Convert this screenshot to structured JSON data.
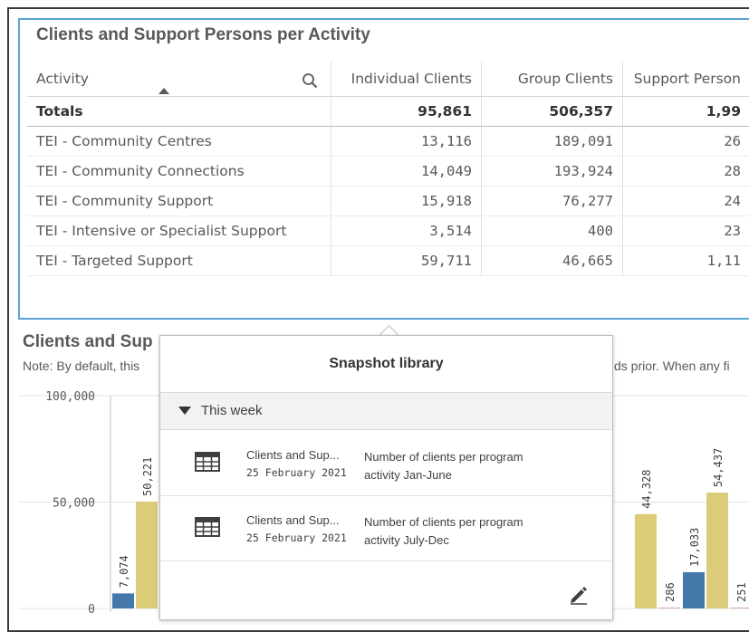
{
  "table": {
    "title": "Clients and Support Persons per Activity",
    "headers": [
      "Activity",
      "Individual Clients",
      "Group Clients",
      "Support Person"
    ],
    "totals": {
      "label": "Totals",
      "individual": "95,861",
      "group": "506,357",
      "support": "1,99"
    },
    "rows": [
      {
        "activity": "TEI - Community Centres",
        "individual": "13,116",
        "group": "189,091",
        "support": "26"
      },
      {
        "activity": "TEI - Community Connections",
        "individual": "14,049",
        "group": "193,924",
        "support": "28"
      },
      {
        "activity": "TEI - Community Support",
        "individual": "15,918",
        "group": "76,277",
        "support": "24"
      },
      {
        "activity": "TEI - Intensive or Specialist Support",
        "individual": "3,514",
        "group": "400",
        "support": "23"
      },
      {
        "activity": "TEI - Targeted Support",
        "individual": "59,711",
        "group": "46,665",
        "support": "1,11"
      }
    ]
  },
  "chart_section": {
    "title": "Clients and Sup",
    "note_left": "Note: By default, this",
    "note_right": "ds prior. When any fi"
  },
  "chart_data": {
    "type": "bar",
    "ylim": [
      0,
      100000
    ],
    "yticks": [
      "100,000",
      "50,000",
      "0"
    ],
    "colors": {
      "blue": "#4477aa",
      "gold": "#dccb78"
    },
    "bars": [
      {
        "group": 0,
        "series": "blue",
        "value": 7074,
        "label": "7,074"
      },
      {
        "group": 0,
        "series": "gold",
        "value": 50221,
        "label": "50,221"
      },
      {
        "group": 5,
        "series": "gold",
        "value": 44328,
        "label": "44,328"
      },
      {
        "group": 5,
        "series": "pink",
        "value": 286,
        "label": "286"
      },
      {
        "group": 6,
        "series": "blue",
        "value": 17033,
        "label": "17,033"
      },
      {
        "group": 6,
        "series": "gold",
        "value": 54437,
        "label": "54,437"
      },
      {
        "group": 6,
        "series": "pink",
        "value": 251,
        "label": "251"
      }
    ]
  },
  "popover": {
    "title": "Snapshot library",
    "group_label": "This week",
    "snapshots": [
      {
        "name": "Clients and Sup...",
        "date": "25 February 2021",
        "description": "Number of clients per program activity Jan-June"
      },
      {
        "name": "Clients and Sup...",
        "date": "25 February 2021",
        "description": "Number of clients per program activity July-Dec"
      }
    ]
  }
}
